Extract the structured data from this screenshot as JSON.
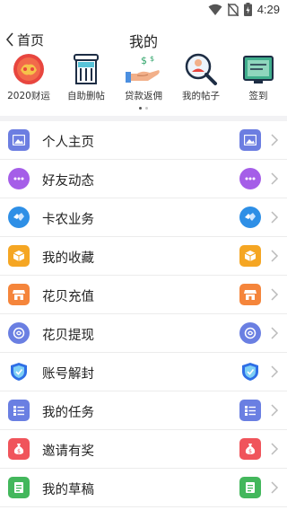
{
  "status": {
    "time": "4:29"
  },
  "nav": {
    "back_label": "首页",
    "title": "我的"
  },
  "shortcuts": [
    {
      "label": "2020财运",
      "icon": "fortune-icon"
    },
    {
      "label": "自助删帖",
      "icon": "trash-bin-icon"
    },
    {
      "label": "贷款返佣",
      "icon": "money-hand-icon"
    },
    {
      "label": "我的帖子",
      "icon": "person-search-icon"
    },
    {
      "label": "签到",
      "icon": "checkin-board-icon"
    }
  ],
  "pager": {
    "pages": 2,
    "active": 0
  },
  "menu": [
    {
      "label": "个人主页",
      "icon": "image-icon",
      "color": "#6c7ee1"
    },
    {
      "label": "好友动态",
      "icon": "chat-bubble-icon",
      "color": "#a55ee8"
    },
    {
      "label": "卡农业务",
      "icon": "handshake-icon",
      "color": "#2e8fe6"
    },
    {
      "label": "我的收藏",
      "icon": "box-icon",
      "color": "#f5a623"
    },
    {
      "label": "花贝充值",
      "icon": "shop-icon",
      "color": "#f5853b"
    },
    {
      "label": "花贝提现",
      "icon": "coin-icon",
      "color": "#6a7fe2"
    },
    {
      "label": "账号解封",
      "icon": "shield-icon",
      "color": "#2f6fe6"
    },
    {
      "label": "我的任务",
      "icon": "task-list-icon",
      "color": "#6a7fe2"
    },
    {
      "label": "邀请有奖",
      "icon": "gift-bag-icon",
      "color": "#f0545b"
    },
    {
      "label": "我的草稿",
      "icon": "draft-icon",
      "color": "#43b75c"
    }
  ]
}
